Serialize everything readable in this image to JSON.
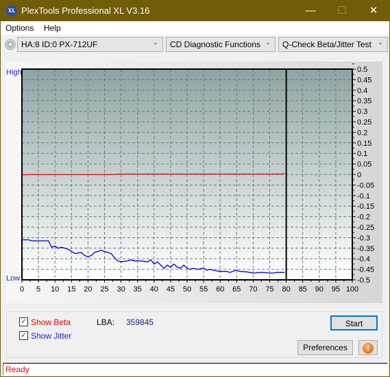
{
  "window": {
    "title": "PlexTools Professional XL V3.16",
    "logo": "XL",
    "minimize": "—",
    "maximize": "☐",
    "close": "✕"
  },
  "menu": {
    "items": [
      "Options",
      "Help"
    ]
  },
  "toolbar": {
    "drive": "HA:8 ID:0  PX-712UF",
    "function": "CD Diagnostic Functions",
    "test": "Q-Check Beta/Jitter Test"
  },
  "controls": {
    "show_beta": "Show Beta",
    "show_jitter": "Show Jitter",
    "show_beta_checked": true,
    "show_jitter_checked": true,
    "lba_label": "LBA:",
    "lba_value": "359845",
    "start": "Start",
    "preferences": "Preferences",
    "info_icon": "i"
  },
  "status": "Ready",
  "colors": {
    "beta": "#e00000",
    "jitter": "#0000cc",
    "label_blue": "#2222cc"
  },
  "chart_data": {
    "type": "line",
    "left_labels": {
      "high": "High",
      "low": "Low"
    },
    "xlim": [
      0,
      100
    ],
    "ylim": [
      -0.5,
      0.5
    ],
    "x_ticks": [
      0,
      5,
      10,
      15,
      20,
      25,
      30,
      35,
      40,
      45,
      50,
      55,
      60,
      65,
      70,
      75,
      80,
      85,
      90,
      95,
      100
    ],
    "y_ticks": [
      "0.5",
      "0.45",
      "0.4",
      "0.35",
      "0.3",
      "0.25",
      "0.2",
      "0.15",
      "0.1",
      "0.05",
      "0",
      "-0.05",
      "-0.1",
      "-0.15",
      "-0.2",
      "-0.25",
      "-0.3",
      "-0.35",
      "-0.4",
      "-0.45",
      "-0.5"
    ],
    "end_marker_x": 80,
    "grid": true,
    "series": [
      {
        "name": "Beta",
        "color": "#e00000",
        "x": [
          0,
          1,
          2,
          5,
          10,
          20,
          28,
          29,
          30,
          35,
          40,
          50,
          60,
          70,
          79,
          79.5
        ],
        "y": [
          0.0,
          -0.002,
          0.0,
          0.0,
          0.0,
          0.0,
          0.0,
          0.002,
          0.002,
          0.002,
          0.002,
          0.002,
          0.002,
          0.002,
          0.002,
          0.005
        ]
      },
      {
        "name": "Jitter",
        "color": "#0000cc",
        "x": [
          0,
          2,
          3,
          5,
          8,
          9,
          10,
          11,
          12,
          14,
          15,
          16,
          18,
          19,
          20,
          21,
          22,
          24,
          25,
          26,
          27,
          28,
          29,
          30,
          32,
          33,
          34,
          35,
          36,
          38,
          39,
          40,
          41,
          42,
          43,
          44,
          45,
          46,
          47,
          48,
          49,
          50,
          51,
          52,
          53,
          55,
          56,
          57,
          58,
          60,
          62,
          63,
          64,
          65,
          66,
          68,
          69,
          70,
          72,
          73,
          75,
          76,
          77,
          79.5
        ],
        "y": [
          -0.31,
          -0.31,
          -0.315,
          -0.315,
          -0.315,
          -0.345,
          -0.34,
          -0.35,
          -0.345,
          -0.355,
          -0.365,
          -0.375,
          -0.37,
          -0.385,
          -0.39,
          -0.385,
          -0.37,
          -0.36,
          -0.365,
          -0.37,
          -0.375,
          -0.395,
          -0.41,
          -0.415,
          -0.41,
          -0.405,
          -0.41,
          -0.41,
          -0.41,
          -0.415,
          -0.405,
          -0.425,
          -0.415,
          -0.43,
          -0.445,
          -0.43,
          -0.44,
          -0.425,
          -0.44,
          -0.445,
          -0.43,
          -0.445,
          -0.45,
          -0.445,
          -0.45,
          -0.445,
          -0.455,
          -0.45,
          -0.455,
          -0.46,
          -0.46,
          -0.465,
          -0.458,
          -0.455,
          -0.46,
          -0.462,
          -0.465,
          -0.468,
          -0.465,
          -0.465,
          -0.468,
          -0.468,
          -0.465,
          -0.465
        ]
      }
    ]
  }
}
